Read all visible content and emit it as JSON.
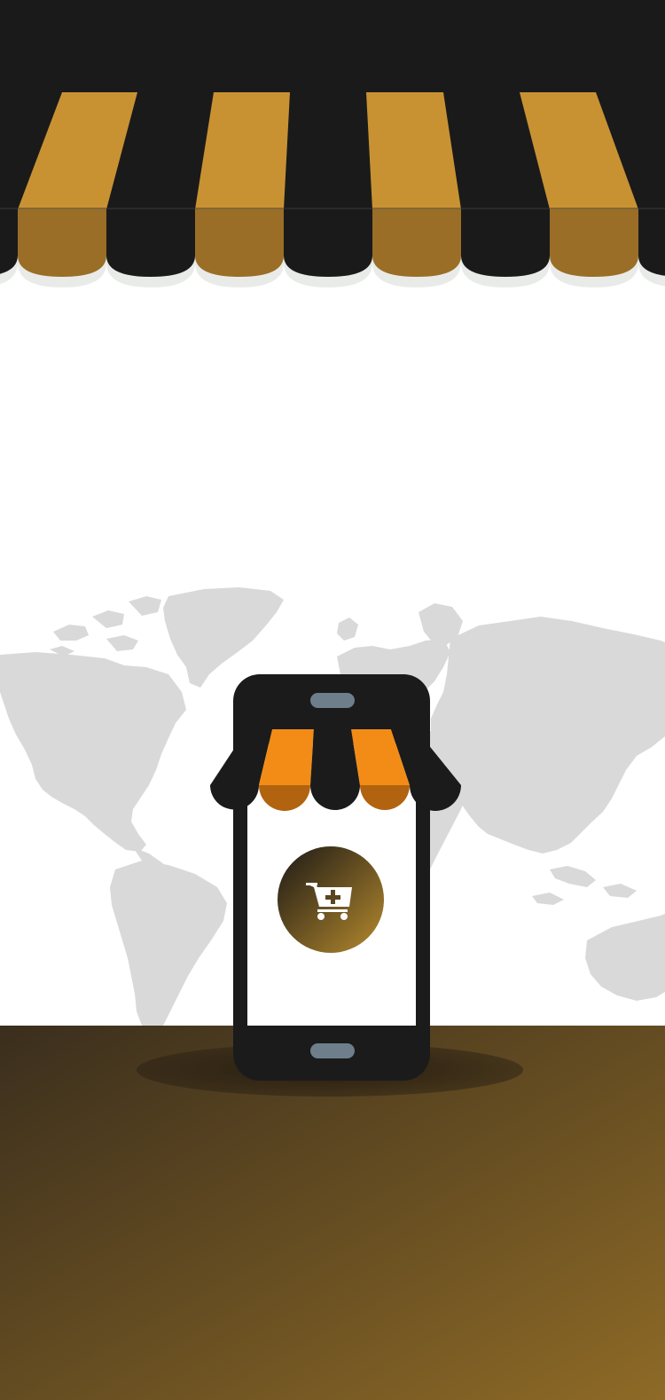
{
  "screen": "splash",
  "colors": {
    "awning_dark": "#1a1a1a",
    "awning_gold": "#c89233",
    "awning_gold_shade": "#9a6e26",
    "map_gray": "#d9d9d9",
    "floor_dark": "#3a2e1d",
    "floor_light": "#8e6a26",
    "phone_body": "#1b1b1b",
    "phone_slot": "#6e7f8b",
    "phone_awning_orange": "#f28c17",
    "phone_awning_orange_shade": "#b2630f",
    "cart_badge_dark": "#2b2418",
    "cart_badge_light": "#b58a2e"
  },
  "icons": {
    "cart": "shopping-cart-add-icon",
    "map": "world-map",
    "awning": "storefront-awning"
  }
}
